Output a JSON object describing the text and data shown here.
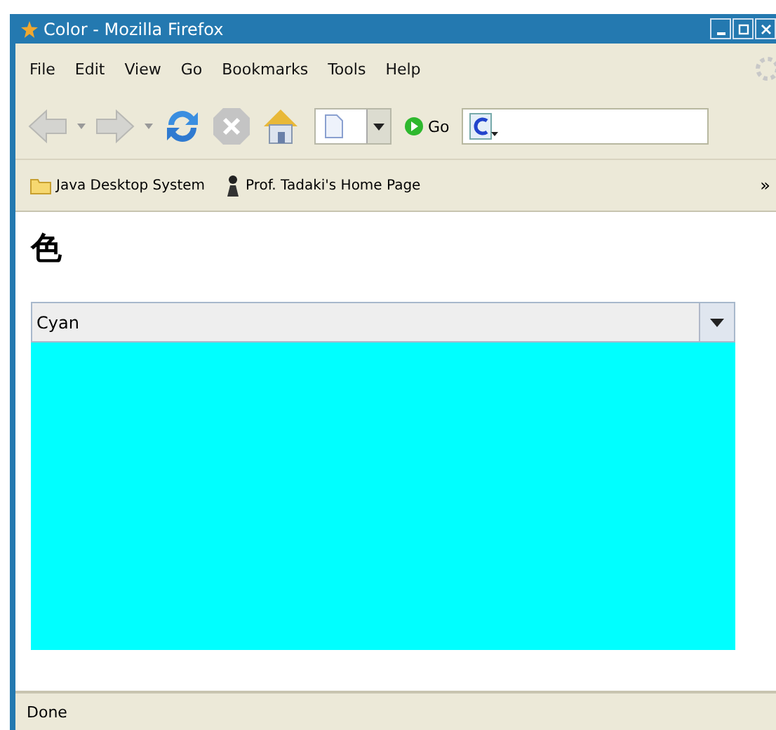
{
  "window": {
    "title": "Color - Mozilla Firefox"
  },
  "menu": [
    "File",
    "Edit",
    "View",
    "Go",
    "Bookmarks",
    "Tools",
    "Help"
  ],
  "toolbar": {
    "go_label": "Go"
  },
  "bookmarks": [
    {
      "kind": "folder",
      "label": "Java Desktop System"
    },
    {
      "kind": "page",
      "label": "Prof. Tadaki's Home Page"
    }
  ],
  "bookmarks_more": "»",
  "page": {
    "heading": "色",
    "combo": {
      "value": "Cyan"
    },
    "swatch": {
      "color": "#00ffff"
    }
  },
  "status_bar": "Done"
}
